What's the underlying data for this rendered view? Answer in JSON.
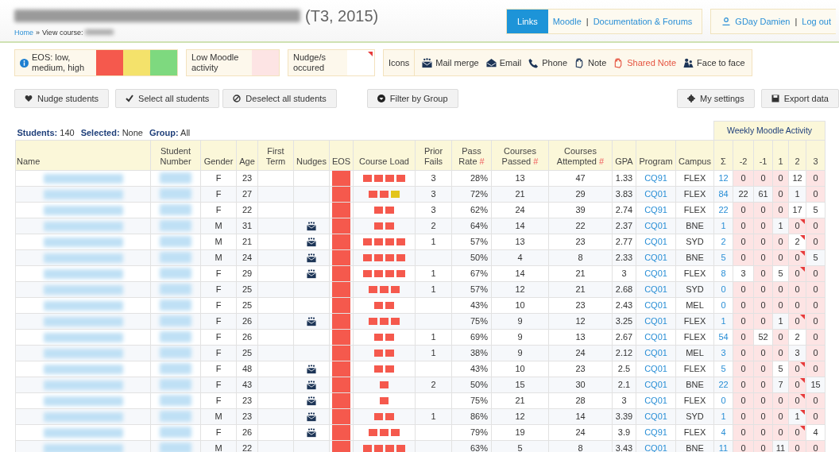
{
  "header": {
    "title_suffix": "(T3, 2015)",
    "breadcrumb": [
      {
        "label": "Home",
        "kind": "link"
      },
      {
        "label": "»",
        "kind": "separator"
      },
      {
        "label": "View course:",
        "kind": "text"
      }
    ],
    "links": {
      "button": "Links",
      "items": [
        {
          "label": "Moodle",
          "kind": "link"
        },
        {
          "label": "|",
          "kind": "separator"
        },
        {
          "label": "Documentation & Forums",
          "kind": "link"
        }
      ]
    },
    "user": [
      {
        "label": "GDay Damien",
        "kind": "link"
      },
      {
        "label": "|",
        "kind": "separator"
      },
      {
        "label": "Log out",
        "kind": "link"
      }
    ]
  },
  "legend": {
    "eos": {
      "label": "EOS: low, medium, high",
      "swatches": [
        {
          "color": "#f5594d"
        },
        {
          "color": "#f4e26b"
        },
        {
          "color": "#7ed97f"
        }
      ]
    },
    "low_activity": {
      "label": "Low Moodle activity",
      "color": "#fde4e4"
    },
    "nudge": {
      "label": "Nudge/s occured"
    },
    "icons_label": "Icons",
    "icons": [
      {
        "kind": "mail",
        "label": "Mail merge"
      },
      {
        "kind": "email",
        "label": "Email"
      },
      {
        "kind": "phone",
        "label": "Phone"
      },
      {
        "kind": "note",
        "label": "Note"
      },
      {
        "kind": "shared",
        "label": "Shared Note"
      },
      {
        "kind": "face",
        "label": "Face to face"
      }
    ]
  },
  "buttons_left": [
    {
      "kind": "heart",
      "label": "Nudge students"
    },
    {
      "kind": "check",
      "label": "Select all students"
    },
    {
      "kind": "ban",
      "label": "Deselect all students"
    },
    {
      "kind": "filter",
      "label": "Filter by Group"
    }
  ],
  "buttons_right": [
    {
      "kind": "gear",
      "label": "My settings"
    },
    {
      "kind": "save",
      "label": "Export data"
    }
  ],
  "stats": [
    {
      "label": "Students:",
      "value": "140"
    },
    {
      "label": "Selected:",
      "value": "None"
    },
    {
      "label": "Group:",
      "value": "All"
    }
  ],
  "table": {
    "group_heading": "Weekly Moodle Activity",
    "columns": [
      {
        "label": "Name"
      },
      {
        "label": "Student Number"
      },
      {
        "label": "Gender"
      },
      {
        "label": "Age"
      },
      {
        "label": "First Term"
      },
      {
        "label": "Nudges"
      },
      {
        "label": "EOS"
      },
      {
        "label": "Course Load"
      },
      {
        "label": "Prior Fails"
      },
      {
        "label": "Pass Rate",
        "mark": "#"
      },
      {
        "label": "Courses Passed",
        "mark": "#"
      },
      {
        "label": "Courses Attempted",
        "mark": "#"
      },
      {
        "label": "GPA"
      },
      {
        "label": "Program"
      },
      {
        "label": "Campus"
      },
      {
        "label": "Σ"
      },
      {
        "label": "-2"
      },
      {
        "label": "-1"
      },
      {
        "label": "1"
      },
      {
        "label": "2"
      },
      {
        "label": "3"
      }
    ],
    "rows": [
      {
        "gender": "F",
        "age": "23",
        "nudged": false,
        "eos": {
          "color": "#f5594d"
        },
        "course_load": [
          {
            "color": "#f5594d"
          },
          {
            "color": "#f5594d"
          },
          {
            "color": "#f5594d"
          },
          {
            "color": "#f5594d"
          }
        ],
        "prior_fails": "3",
        "pass_rate": "28%",
        "passed": "13",
        "attempted": "47",
        "gpa": "1.33",
        "program": "CQ91",
        "campus": "FLEX",
        "total": "12",
        "weeks": [
          {
            "value": "0",
            "low": true,
            "nudged": false
          },
          {
            "value": "0",
            "low": true,
            "nudged": false
          },
          {
            "value": "0",
            "low": true,
            "nudged": false
          },
          {
            "value": "12",
            "low": false,
            "nudged": false
          },
          {
            "value": "0",
            "low": true,
            "nudged": false
          }
        ]
      },
      {
        "gender": "F",
        "age": "27",
        "nudged": false,
        "eos": {
          "color": "#f5594d"
        },
        "course_load": [
          {
            "color": "#f5594d"
          },
          {
            "color": "#f5594d"
          },
          {
            "color": "#e3c51b"
          }
        ],
        "prior_fails": "3",
        "pass_rate": "72%",
        "passed": "21",
        "attempted": "29",
        "gpa": "3.83",
        "program": "CQ01",
        "campus": "FLEX",
        "total": "84",
        "weeks": [
          {
            "value": "22",
            "low": false,
            "nudged": false
          },
          {
            "value": "61",
            "low": false,
            "nudged": false
          },
          {
            "value": "0",
            "low": true,
            "nudged": false
          },
          {
            "value": "1",
            "low": false,
            "nudged": false
          },
          {
            "value": "0",
            "low": true,
            "nudged": false
          }
        ]
      },
      {
        "gender": "F",
        "age": "22",
        "nudged": false,
        "eos": {
          "color": "#f5594d"
        },
        "course_load": [
          {
            "color": "#f5594d"
          },
          {
            "color": "#f5594d"
          }
        ],
        "prior_fails": "3",
        "pass_rate": "62%",
        "passed": "24",
        "attempted": "39",
        "gpa": "2.74",
        "program": "CQ91",
        "campus": "FLEX",
        "total": "22",
        "weeks": [
          {
            "value": "0",
            "low": true,
            "nudged": false
          },
          {
            "value": "0",
            "low": true,
            "nudged": false
          },
          {
            "value": "0",
            "low": true,
            "nudged": false
          },
          {
            "value": "17",
            "low": false,
            "nudged": false
          },
          {
            "value": "5",
            "low": false,
            "nudged": false
          }
        ]
      },
      {
        "gender": "M",
        "age": "31",
        "nudged": true,
        "eos": {
          "color": "#f5594d"
        },
        "course_load": [
          {
            "color": "#f5594d"
          },
          {
            "color": "#f5594d"
          }
        ],
        "prior_fails": "2",
        "pass_rate": "64%",
        "passed": "14",
        "attempted": "22",
        "gpa": "2.37",
        "program": "CQ01",
        "campus": "BNE",
        "total": "1",
        "weeks": [
          {
            "value": "0",
            "low": true,
            "nudged": false
          },
          {
            "value": "0",
            "low": true,
            "nudged": false
          },
          {
            "value": "1",
            "low": false,
            "nudged": false
          },
          {
            "value": "0",
            "low": true,
            "nudged": true
          },
          {
            "value": "0",
            "low": true,
            "nudged": false
          }
        ]
      },
      {
        "gender": "M",
        "age": "21",
        "nudged": true,
        "eos": {
          "color": "#f5594d"
        },
        "course_load": [
          {
            "color": "#f5594d"
          },
          {
            "color": "#f5594d"
          },
          {
            "color": "#f5594d"
          },
          {
            "color": "#f5594d"
          }
        ],
        "prior_fails": "1",
        "pass_rate": "57%",
        "passed": "13",
        "attempted": "23",
        "gpa": "2.77",
        "program": "CQ01",
        "campus": "SYD",
        "total": "2",
        "weeks": [
          {
            "value": "0",
            "low": true,
            "nudged": false
          },
          {
            "value": "0",
            "low": true,
            "nudged": false
          },
          {
            "value": "0",
            "low": true,
            "nudged": false
          },
          {
            "value": "2",
            "low": false,
            "nudged": true
          },
          {
            "value": "0",
            "low": true,
            "nudged": false
          }
        ]
      },
      {
        "gender": "M",
        "age": "24",
        "nudged": true,
        "eos": {
          "color": "#f5594d"
        },
        "course_load": [
          {
            "color": "#f5594d"
          },
          {
            "color": "#f5594d"
          },
          {
            "color": "#f5594d"
          },
          {
            "color": "#f5594d"
          }
        ],
        "pass_rate": "50%",
        "passed": "4",
        "attempted": "8",
        "gpa": "2.33",
        "program": "CQ01",
        "campus": "BNE",
        "total": "5",
        "weeks": [
          {
            "value": "0",
            "low": true,
            "nudged": false
          },
          {
            "value": "0",
            "low": true,
            "nudged": false
          },
          {
            "value": "0",
            "low": true,
            "nudged": false
          },
          {
            "value": "0",
            "low": true,
            "nudged": true
          },
          {
            "value": "5",
            "low": false,
            "nudged": false
          }
        ]
      },
      {
        "gender": "F",
        "age": "29",
        "nudged": true,
        "eos": {
          "color": "#f5594d"
        },
        "course_load": [
          {
            "color": "#f5594d"
          },
          {
            "color": "#f5594d"
          },
          {
            "color": "#f5594d"
          },
          {
            "color": "#f5594d"
          }
        ],
        "prior_fails": "1",
        "pass_rate": "67%",
        "passed": "14",
        "attempted": "21",
        "gpa": "3",
        "program": "CQ01",
        "campus": "FLEX",
        "total": "8",
        "weeks": [
          {
            "value": "3",
            "low": false,
            "nudged": false
          },
          {
            "value": "0",
            "low": true,
            "nudged": false
          },
          {
            "value": "5",
            "low": false,
            "nudged": false
          },
          {
            "value": "0",
            "low": true,
            "nudged": true
          },
          {
            "value": "0",
            "low": true,
            "nudged": false
          }
        ]
      },
      {
        "gender": "F",
        "age": "25",
        "nudged": false,
        "eos": {
          "color": "#f5594d"
        },
        "course_load": [
          {
            "color": "#f5594d"
          },
          {
            "color": "#f5594d"
          },
          {
            "color": "#f5594d"
          }
        ],
        "prior_fails": "1",
        "pass_rate": "57%",
        "passed": "12",
        "attempted": "21",
        "gpa": "2.68",
        "program": "CQ01",
        "campus": "SYD",
        "total": "0",
        "weeks": [
          {
            "value": "0",
            "low": true,
            "nudged": false
          },
          {
            "value": "0",
            "low": true,
            "nudged": false
          },
          {
            "value": "0",
            "low": true,
            "nudged": false
          },
          {
            "value": "0",
            "low": true,
            "nudged": false
          },
          {
            "value": "0",
            "low": true,
            "nudged": false
          }
        ]
      },
      {
        "gender": "F",
        "age": "25",
        "nudged": false,
        "eos": {
          "color": "#f5594d"
        },
        "course_load": [
          {
            "color": "#f5594d"
          },
          {
            "color": "#f5594d"
          }
        ],
        "pass_rate": "43%",
        "passed": "10",
        "attempted": "23",
        "gpa": "2.43",
        "program": "CQ01",
        "campus": "MEL",
        "total": "0",
        "weeks": [
          {
            "value": "0",
            "low": true,
            "nudged": false
          },
          {
            "value": "0",
            "low": true,
            "nudged": false
          },
          {
            "value": "0",
            "low": true,
            "nudged": false
          },
          {
            "value": "0",
            "low": true,
            "nudged": false
          },
          {
            "value": "0",
            "low": true,
            "nudged": false
          }
        ]
      },
      {
        "gender": "F",
        "age": "26",
        "nudged": true,
        "eos": {
          "color": "#f5594d"
        },
        "course_load": [
          {
            "color": "#f5594d"
          },
          {
            "color": "#f5594d"
          },
          {
            "color": "#f5594d"
          }
        ],
        "pass_rate": "75%",
        "passed": "9",
        "attempted": "12",
        "gpa": "3.25",
        "program": "CQ01",
        "campus": "FLEX",
        "total": "1",
        "weeks": [
          {
            "value": "0",
            "low": true,
            "nudged": false
          },
          {
            "value": "0",
            "low": true,
            "nudged": false
          },
          {
            "value": "1",
            "low": false,
            "nudged": false
          },
          {
            "value": "0",
            "low": true,
            "nudged": true
          },
          {
            "value": "0",
            "low": true,
            "nudged": false
          }
        ]
      },
      {
        "gender": "F",
        "age": "26",
        "nudged": false,
        "eos": {
          "color": "#f5594d"
        },
        "course_load": [
          {
            "color": "#f5594d"
          },
          {
            "color": "#f5594d"
          }
        ],
        "prior_fails": "1",
        "pass_rate": "69%",
        "passed": "9",
        "attempted": "13",
        "gpa": "2.67",
        "program": "CQ01",
        "campus": "FLEX",
        "total": "54",
        "weeks": [
          {
            "value": "0",
            "low": true,
            "nudged": false
          },
          {
            "value": "52",
            "low": false,
            "nudged": false
          },
          {
            "value": "0",
            "low": true,
            "nudged": false
          },
          {
            "value": "2",
            "low": false,
            "nudged": false
          },
          {
            "value": "0",
            "low": true,
            "nudged": false
          }
        ]
      },
      {
        "gender": "F",
        "age": "25",
        "nudged": false,
        "eos": {
          "color": "#f5594d"
        },
        "course_load": [
          {
            "color": "#f5594d"
          },
          {
            "color": "#f5594d"
          }
        ],
        "prior_fails": "1",
        "pass_rate": "38%",
        "passed": "9",
        "attempted": "24",
        "gpa": "2.12",
        "program": "CQ01",
        "campus": "MEL",
        "total": "3",
        "weeks": [
          {
            "value": "0",
            "low": true,
            "nudged": false
          },
          {
            "value": "0",
            "low": true,
            "nudged": false
          },
          {
            "value": "0",
            "low": true,
            "nudged": false
          },
          {
            "value": "3",
            "low": false,
            "nudged": false
          },
          {
            "value": "0",
            "low": true,
            "nudged": false
          }
        ]
      },
      {
        "gender": "F",
        "age": "48",
        "nudged": true,
        "eos": {
          "color": "#f5594d"
        },
        "course_load": [
          {
            "color": "#f5594d"
          },
          {
            "color": "#f5594d"
          }
        ],
        "pass_rate": "43%",
        "passed": "10",
        "attempted": "23",
        "gpa": "2.5",
        "program": "CQ01",
        "campus": "FLEX",
        "total": "5",
        "weeks": [
          {
            "value": "0",
            "low": true,
            "nudged": false
          },
          {
            "value": "0",
            "low": true,
            "nudged": false
          },
          {
            "value": "5",
            "low": false,
            "nudged": false
          },
          {
            "value": "0",
            "low": true,
            "nudged": true
          },
          {
            "value": "0",
            "low": true,
            "nudged": false
          }
        ]
      },
      {
        "gender": "F",
        "age": "43",
        "nudged": true,
        "eos": {
          "color": "#f5594d"
        },
        "course_load": [
          {
            "color": "#f5594d"
          }
        ],
        "prior_fails": "2",
        "pass_rate": "50%",
        "passed": "15",
        "attempted": "30",
        "gpa": "2.1",
        "program": "CQ01",
        "campus": "BNE",
        "total": "22",
        "weeks": [
          {
            "value": "0",
            "low": true,
            "nudged": false
          },
          {
            "value": "0",
            "low": true,
            "nudged": false
          },
          {
            "value": "7",
            "low": false,
            "nudged": false
          },
          {
            "value": "0",
            "low": true,
            "nudged": true
          },
          {
            "value": "15",
            "low": false,
            "nudged": false
          }
        ]
      },
      {
        "gender": "F",
        "age": "23",
        "nudged": true,
        "eos": {
          "color": "#f5594d"
        },
        "course_load": [
          {
            "color": "#f5594d"
          }
        ],
        "pass_rate": "75%",
        "passed": "21",
        "attempted": "28",
        "gpa": "3",
        "program": "CQ01",
        "campus": "FLEX",
        "total": "0",
        "weeks": [
          {
            "value": "0",
            "low": true,
            "nudged": false
          },
          {
            "value": "0",
            "low": true,
            "nudged": false
          },
          {
            "value": "0",
            "low": true,
            "nudged": false
          },
          {
            "value": "0",
            "low": true,
            "nudged": true
          },
          {
            "value": "0",
            "low": true,
            "nudged": false
          }
        ]
      },
      {
        "gender": "M",
        "age": "23",
        "nudged": true,
        "eos": {
          "color": "#f5594d"
        },
        "course_load": [
          {
            "color": "#f5594d"
          },
          {
            "color": "#f5594d"
          }
        ],
        "prior_fails": "1",
        "pass_rate": "86%",
        "passed": "12",
        "attempted": "14",
        "gpa": "3.39",
        "program": "CQ01",
        "campus": "SYD",
        "total": "1",
        "weeks": [
          {
            "value": "0",
            "low": true,
            "nudged": false
          },
          {
            "value": "0",
            "low": true,
            "nudged": false
          },
          {
            "value": "0",
            "low": true,
            "nudged": false
          },
          {
            "value": "1",
            "low": false,
            "nudged": true
          },
          {
            "value": "0",
            "low": true,
            "nudged": false
          }
        ]
      },
      {
        "gender": "F",
        "age": "26",
        "nudged": true,
        "eos": {
          "color": "#f5594d"
        },
        "course_load": [
          {
            "color": "#f5594d"
          },
          {
            "color": "#f5594d"
          },
          {
            "color": "#f5594d"
          }
        ],
        "pass_rate": "79%",
        "passed": "19",
        "attempted": "24",
        "gpa": "3.9",
        "program": "CQ91",
        "campus": "FLEX",
        "total": "4",
        "weeks": [
          {
            "value": "0",
            "low": true,
            "nudged": false
          },
          {
            "value": "0",
            "low": true,
            "nudged": false
          },
          {
            "value": "0",
            "low": true,
            "nudged": false
          },
          {
            "value": "0",
            "low": true,
            "nudged": true
          },
          {
            "value": "4",
            "low": false,
            "nudged": false
          }
        ]
      },
      {
        "gender": "M",
        "age": "22",
        "nudged": false,
        "eos": {
          "color": "#f5594d"
        },
        "course_load": [
          {
            "color": "#f5594d"
          },
          {
            "color": "#f5594d"
          },
          {
            "color": "#f5594d"
          },
          {
            "color": "#f5594d"
          }
        ],
        "pass_rate": "63%",
        "passed": "5",
        "attempted": "8",
        "gpa": "3.43",
        "program": "CQ01",
        "campus": "BNE",
        "total": "11",
        "weeks": [
          {
            "value": "0",
            "low": true,
            "nudged": false
          },
          {
            "value": "0",
            "low": true,
            "nudged": false
          },
          {
            "value": "11",
            "low": false,
            "nudged": false
          },
          {
            "value": "0",
            "low": true,
            "nudged": false
          },
          {
            "value": "0",
            "low": true,
            "nudged": false
          }
        ]
      }
    ]
  }
}
